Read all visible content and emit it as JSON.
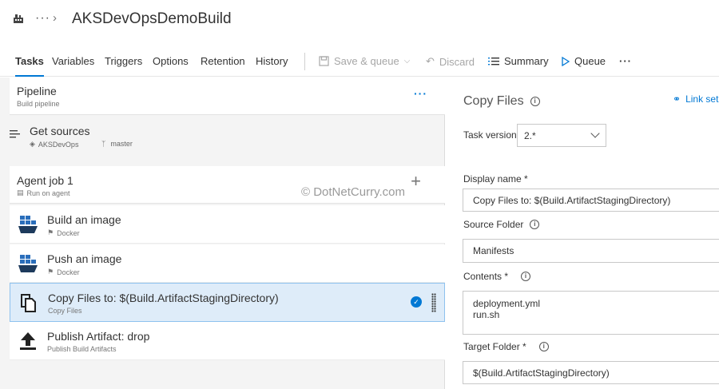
{
  "header": {
    "breadcrumb_more": "···",
    "breadcrumb_chevron": "›",
    "title": "AKSDevOpsDemoBuild",
    "org_icon": "build-org-icon"
  },
  "tabs": [
    {
      "label": "Tasks",
      "active": true
    },
    {
      "label": "Variables"
    },
    {
      "label": "Triggers"
    },
    {
      "label": "Options"
    },
    {
      "label": "Retention"
    },
    {
      "label": "History"
    }
  ],
  "toolbar": {
    "save_queue": "Save & queue",
    "discard": "Discard",
    "summary": "Summary",
    "queue": "Queue",
    "more": "···"
  },
  "pipeline": {
    "title": "Pipeline",
    "subtitle": "Build pipeline",
    "more": "···"
  },
  "get_sources": {
    "title": "Get sources",
    "repo": "AKSDevOps",
    "branch": "master"
  },
  "agent_job": {
    "title": "Agent job 1",
    "subtitle": "Run on agent",
    "add": "+"
  },
  "watermark": "© DotNetCurry.com",
  "tasks": [
    {
      "title": "Build an image",
      "subtitle": "Docker",
      "icon": "docker-icon"
    },
    {
      "title": "Push an image",
      "subtitle": "Docker",
      "icon": "docker-icon"
    },
    {
      "title": "Copy Files to: $(Build.ArtifactStagingDirectory)",
      "subtitle": "Copy Files",
      "icon": "copy-files-icon",
      "selected": true,
      "check": "✓"
    },
    {
      "title": "Publish Artifact: drop",
      "subtitle": "Publish Build Artifacts",
      "icon": "publish-artifact-icon"
    }
  ],
  "panel": {
    "title": "Copy Files",
    "link_settings": "Link set",
    "task_version_label": "Task version",
    "task_version_value": "2.*",
    "display_name_label": "Display name *",
    "display_name_value": "Copy Files to: $(Build.ArtifactStagingDirectory)",
    "source_folder_label": "Source Folder",
    "source_folder_value": "Manifests",
    "contents_label": "Contents *",
    "contents_lines": [
      "deployment.yml",
      "run.sh"
    ],
    "target_folder_label": "Target Folder *",
    "target_folder_value": "$(Build.ArtifactStagingDirectory)",
    "info_glyph": "i"
  },
  "colors": {
    "accent": "#0078d4",
    "selected_bg": "#deecf9",
    "docker_blue": "#2a6ebb",
    "docker_dark": "#1d3a5c"
  }
}
